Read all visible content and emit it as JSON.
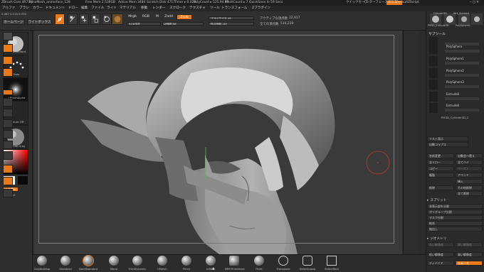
{
  "titlebar": {
    "app": "ZBrush Core 4R7 P4",
    "doc": "DynaMesh_animeface_128",
    "free_mem": "Free Mem 2.539GB",
    "active_mem": "Active Mem 3484",
    "scratch": "Scratch Disk 4717",
    "timer": "Timer ▸ 0.028",
    "polycount": "PolyCount ▸ 525.94 KP",
    "meshcount": "MeshCount ▸ 7",
    "quicksave": "QuickSave In 59 Secs",
    "quick_save_btn": "クイックセーブ",
    "ui_transparency": "インターフェース透明度",
    "menus_btn": "メニュー",
    "default_script": "DefaultZScript"
  },
  "menubar": {
    "items": [
      "アルファ",
      "ブラシ",
      "カラー",
      "ドキュメント",
      "ドロー",
      "編集",
      "ファイル",
      "ライト",
      "マテリアル",
      "移動",
      "レンダー",
      "スクローク",
      "テクスチャ",
      "ツール",
      "トランスフォーム",
      "Zプラグイン"
    ],
    "coords": "0.467 0.115 0.332"
  },
  "toptools": {
    "home_btn": "ホームページ",
    "lightbox_btn": "ライトボックス",
    "mrgb": "Mrgb",
    "rgb": "RGB",
    "m": "M",
    "zadd": "Zadd",
    "zsub": "Zsub",
    "rgb_intensity": "RGB強度",
    "z_intensity_label": "Z強度",
    "z_intensity_val": "34",
    "brush_size_label": "ブラシサイズ",
    "brush_size_val": "46",
    "focal_label": "焦点移動",
    "focal_val": "-20",
    "active_points_label": "アクティブな頂点数",
    "active_points_val": "22,917",
    "total_points_label": "全ての頂点数",
    "total_points_val": "516,219"
  },
  "leftshelf": {
    "brush_label": "DamStandard",
    "stroke_label": "Dots",
    "alpha_label": "~BrushAlpha",
    "texture_label": "Texture Off",
    "material_label": "MatCap Gray",
    "switch_color_btn": "入れ替え",
    "fill_label": "FillObject"
  },
  "rightdock": {
    "labels": [
      "",
      "",
      "",
      "",
      "Move",
      "Scale",
      "Rotate",
      "",
      "",
      "",
      "",
      "PolyF",
      "",
      "",
      "",
      "Transp",
      "",
      "Solo"
    ]
  },
  "subtool_panel": {
    "thumbs": [
      "Cylinder3D",
      "Wrk_Sphere4",
      "PM3D_Extrude3D",
      "PolySphere1"
    ],
    "title": "サブツール",
    "items": [
      "",
      "PolySphere",
      "PolySphere1",
      "PolySphere2",
      "PolySphere3",
      "Extrude6",
      "Extrude6",
      "PM3D_Cylinder3D_2"
    ],
    "list_all": "リスト表示",
    "auto_collapse": "自動コラプス",
    "rename": "名前変更",
    "auto_reorder": "自動並べ替え",
    "all_low": "全ミロー",
    "all_high": "全てハイ",
    "copy": "コピー",
    "paste": "ペースト",
    "duplicate": "複製",
    "append": "アペンド",
    "insert": "挿入",
    "delete": "削除",
    "delete_other": "その他削除",
    "delete_all": "全て削除",
    "split_section": "スプリット",
    "split_hidden": "非表示部を分割",
    "groups_split": "ポリグループ分割",
    "split_masked": "マスク分割",
    "merge": "結合",
    "extract": "抽出し",
    "geometry_section": "ジオメトリ",
    "lower_res": "低い解像度",
    "higher_res": "高い解像度",
    "divide_label": "ディバイド",
    "smooth_btn": "スムース"
  },
  "bottombar": {
    "brushes": [
      "ClayBuildup",
      "Standard",
      "DamStandard",
      "Move",
      "TrimDynamic",
      "hPolish",
      "Pinch",
      "Inflate",
      "IMM Primitives",
      "Paint",
      "Transpose",
      "SelectLasso",
      "SelectRect"
    ],
    "selected_index": 2
  }
}
